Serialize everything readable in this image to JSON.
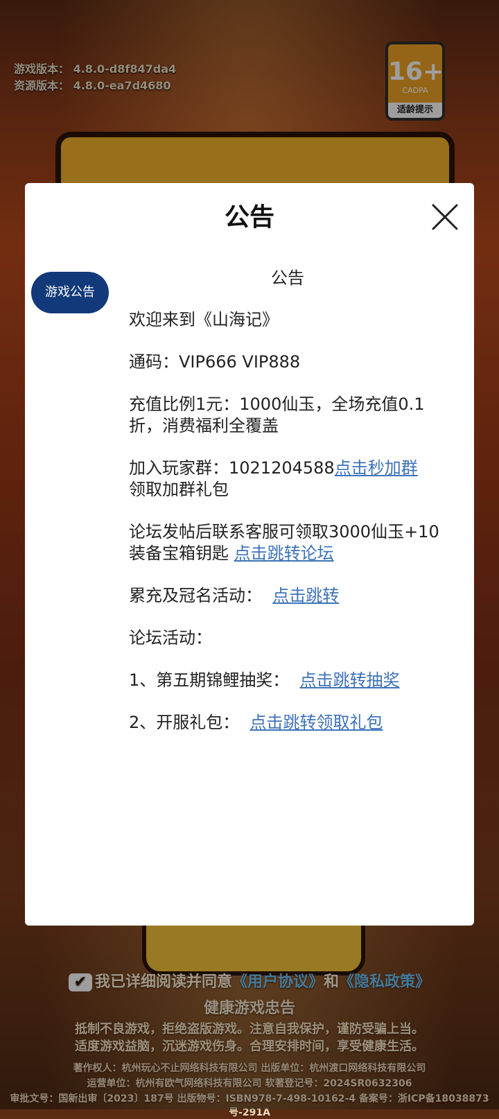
{
  "game": {
    "version_label": "游戏版本：",
    "version_value": "4.8.0-d8f847da4",
    "resource_label": "资源版本：",
    "resource_value": "4.8.0-ea7d4680"
  },
  "age_badge": {
    "age": "16+",
    "org": "CADPA",
    "tip": "适龄提示"
  },
  "dialog": {
    "title": "公告",
    "tab_label": "游戏公告",
    "notice_heading": "公告",
    "welcome": "欢迎来到《山海记》",
    "code_line": "通码：VIP666 VIP888",
    "recharge_line": "充值比例1元：1000仙玉，全场充值0.1折，消费福利全覆盖",
    "group_text": "加入玩家群：1021204588",
    "group_link": "点击秒加群",
    "group_suffix": "领取加群礼包",
    "forum_text": "论坛发帖后联系客服可领取3000仙玉+10装备宝箱钥匙 ",
    "forum_link": "点击跳转论坛",
    "accum_text": "累充及冠名活动：",
    "accum_link": "点击跳转",
    "forum_activity": "论坛活动：",
    "lottery_text": "1、第五期锦鲤抽奖：",
    "lottery_link": "点击跳转抽奖",
    "gift_text": "2、开服礼包：",
    "gift_link": "点击跳转领取礼包"
  },
  "footer": {
    "agree_prefix": "我已详细阅读并同意",
    "user_agreement": "《用户协议》",
    "and": "和",
    "privacy_policy": "《隐私政策》",
    "health_title": "健康游戏忠告",
    "health_line1": "抵制不良游戏，拒绝盗版游戏。注意自我保护，谨防受骗上当。",
    "health_line2": "适度游戏益脑，沉迷游戏伤身。合理安排时间，享受健康生活。",
    "copyright": "著作权人：杭州玩心不止网络科技有限公司 出版单位：杭州渡口网络科技有限公司",
    "operator": "运营单位：杭州有欧气网络科技有限公司 软著登记号：2024SR0632306",
    "approval": "审批文号：国新出审〔2023〕187号 出版物号：ISBN978-7-498-10162-4 备案号：浙ICP备18038873号-291A"
  },
  "colors": {
    "tab_bg": "#123a7a",
    "link": "#3d72b8",
    "badge": "#f0a326"
  }
}
